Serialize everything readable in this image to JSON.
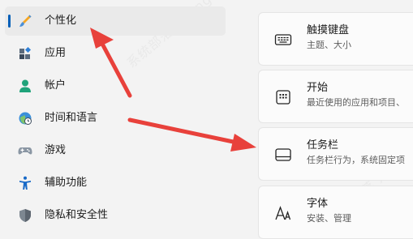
{
  "sidebar": {
    "items": [
      {
        "label": "个性化",
        "icon": "brush-icon"
      },
      {
        "label": "应用",
        "icon": "apps-icon"
      },
      {
        "label": "帐户",
        "icon": "account-icon"
      },
      {
        "label": "时间和语言",
        "icon": "globe-clock-icon"
      },
      {
        "label": "游戏",
        "icon": "gamepad-icon"
      },
      {
        "label": "辅助功能",
        "icon": "accessibility-icon"
      },
      {
        "label": "隐私和安全性",
        "icon": "shield-icon"
      }
    ]
  },
  "cards": [
    {
      "title": "触摸键盘",
      "subtitle": "主题、大小",
      "icon": "keyboard-icon"
    },
    {
      "title": "开始",
      "subtitle": "最近使用的应用和项目、",
      "icon": "start-icon"
    },
    {
      "title": "任务栏",
      "subtitle": "任务栏行为，系统固定项",
      "icon": "taskbar-icon"
    },
    {
      "title": "字体",
      "subtitle": "安装、管理",
      "icon": "font-icon"
    }
  ],
  "watermark": {
    "text": "系统部落 xitongbuluo.com"
  },
  "colors": {
    "accent": "#005fb8",
    "annotation_arrow": "#e8413b"
  }
}
